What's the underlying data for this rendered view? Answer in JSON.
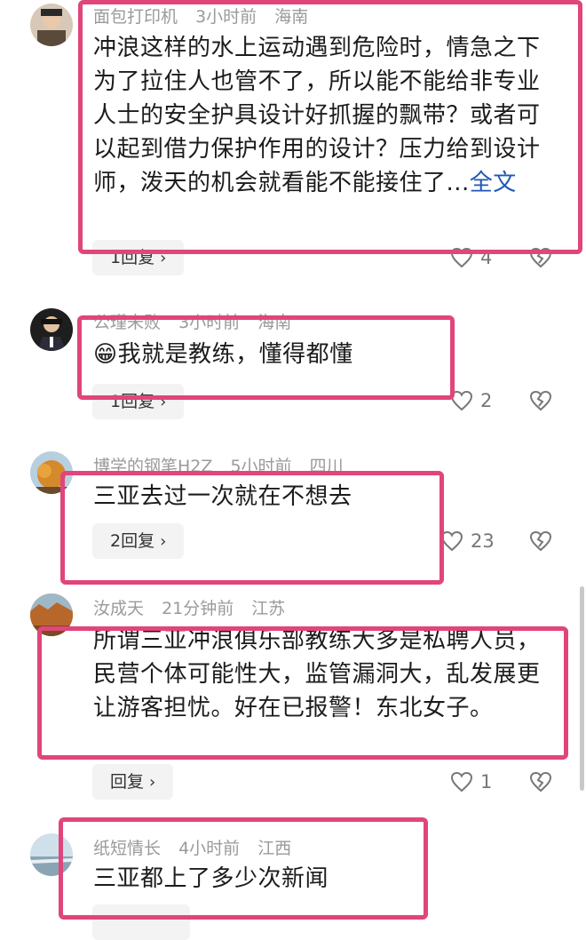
{
  "comments": [
    {
      "user": "面包打印机",
      "time": "3小时前",
      "location": "海南",
      "text": "冲浪这样的水上运动遇到危险时，情急之下为了拉住人也管不了，所以能不能给非专业人士的安全护具设计好抓握的飘带？或者可以起到借力保护作用的设计？压力给到设计师，泼天的机会就看能不能接住了...",
      "more": "全文",
      "reply_label": "1回复",
      "likes": "4"
    },
    {
      "user": "公瑾未败",
      "time": "3小时前",
      "location": "海南",
      "emoji": "😁",
      "text": "我就是教练，懂得都懂",
      "reply_label": "1回复",
      "likes": "2"
    },
    {
      "user": "博学的钢笔H2Z",
      "time": "5小时前",
      "location": "四川",
      "text": "三亚去过一次就在不想去",
      "reply_label": "2回复",
      "likes": "23"
    },
    {
      "user": "汝成天",
      "time": "21分钟前",
      "location": "江苏",
      "text": "所谓三亚冲浪俱乐部教练大多是私聘人员，民营个体可能性大，监管漏洞大，乱发展更让游客担忧。好在已报警！东北女子。",
      "reply_label": "回复",
      "likes": "1"
    },
    {
      "user": "纸短情长",
      "time": "4小时前",
      "location": "江西",
      "text": "三亚都上了多少次新闻"
    }
  ],
  "colors": {
    "highlight": "#e0457b",
    "link": "#1f57b8",
    "meta": "#9a9a9a"
  },
  "icons": {
    "like": "heart-outline-icon",
    "dislike": "broken-heart-icon",
    "reply_chevron": "chevron-right-icon"
  }
}
